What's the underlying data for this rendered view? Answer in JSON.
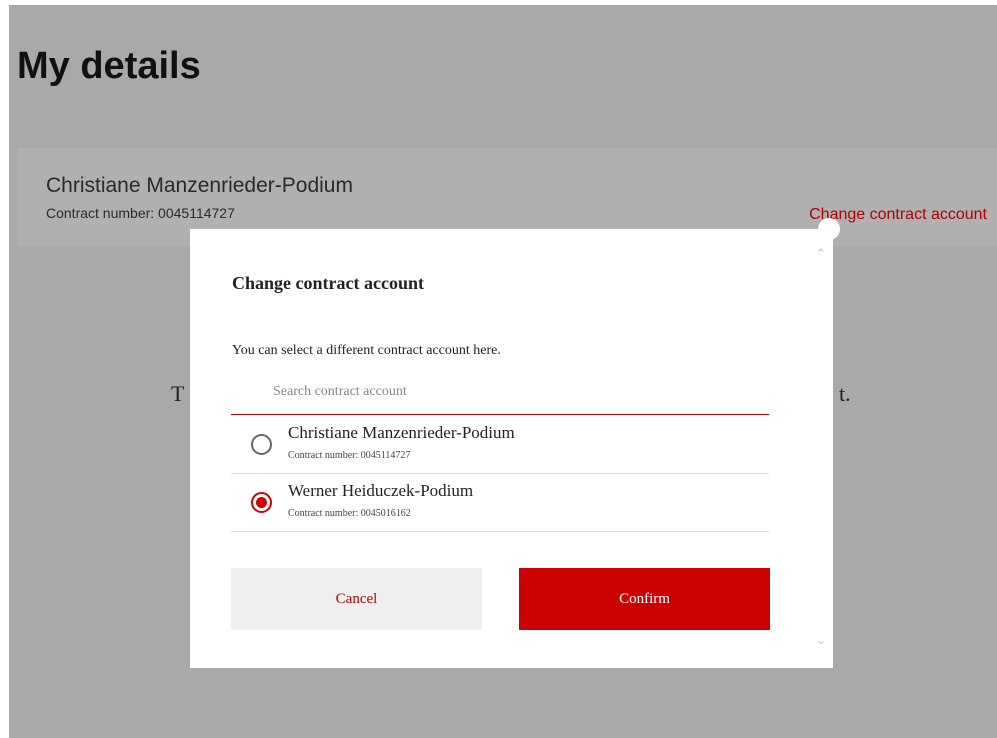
{
  "page": {
    "title": "My details"
  },
  "account_card": {
    "name": "Christiane Manzenrieder-Podium",
    "contract_number": "Contract number: 0045114727",
    "change_link": "Change contract account"
  },
  "background_text": {
    "left_fragment": "T",
    "right_fragment": "t."
  },
  "modal": {
    "title": "Change contract account",
    "description": "You can select a different contract account here.",
    "search": {
      "placeholder": "Search contract account",
      "value": ""
    },
    "options": [
      {
        "name": "Christiane Manzenrieder-Podium",
        "contract_number": "Contract number: 0045114727",
        "selected": false
      },
      {
        "name": "Werner Heiduczek-Podium",
        "contract_number": "Contract number: 0045016162",
        "selected": true
      }
    ],
    "cancel_label": "Cancel",
    "confirm_label": "Confirm",
    "scroll_up_icon": "chevron-up-icon",
    "scroll_down_icon": "chevron-down-icon"
  },
  "colors": {
    "accent": "#cc0000",
    "link": "#b30000",
    "overlay_background": "#a9a9a9"
  }
}
